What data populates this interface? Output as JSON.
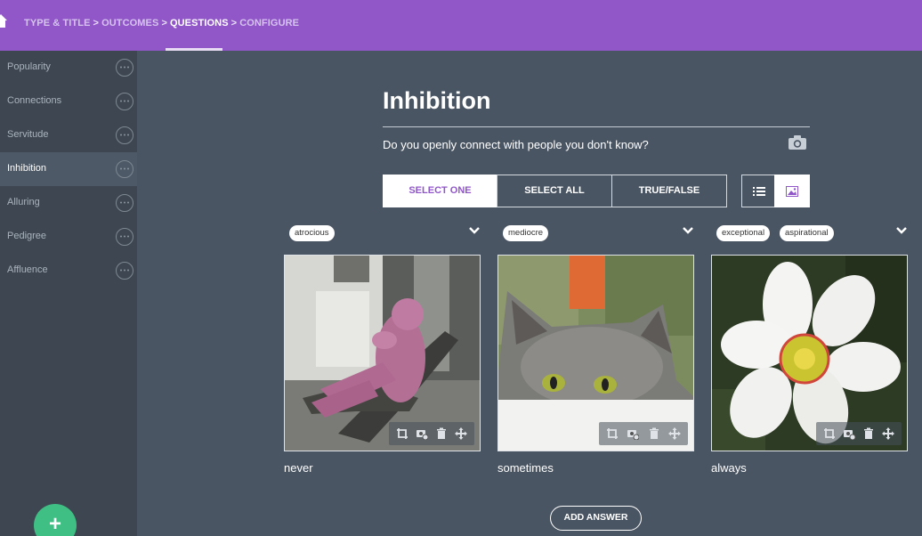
{
  "breadcrumb": {
    "steps": [
      "TYPE & TITLE",
      "OUTCOMES",
      "QUESTIONS",
      "CONFIGURE"
    ],
    "separator": ">"
  },
  "sidebar": {
    "items": [
      {
        "label": "Popularity"
      },
      {
        "label": "Connections"
      },
      {
        "label": "Servitude"
      },
      {
        "label": "Inhibition"
      },
      {
        "label": "Alluring"
      },
      {
        "label": "Pedigree"
      },
      {
        "label": "Affluence"
      }
    ],
    "active_item": "Inhibition",
    "add_label": "+"
  },
  "question": {
    "title": "Inhibition",
    "text": "Do you openly connect with people you don't know?",
    "types": [
      "SELECT ONE",
      "SELECT ALL",
      "TRUE/FALSE"
    ],
    "selected_type": "SELECT ONE",
    "view_modes": [
      "list-icon",
      "image-icon"
    ],
    "selected_view": "image-icon"
  },
  "answers": [
    {
      "label": "never",
      "tags": [
        "atrocious"
      ],
      "image": "person-in-pink-knit-suit"
    },
    {
      "label": "sometimes",
      "tags": [
        "mediocre"
      ],
      "image": "grey-cat-peeking"
    },
    {
      "label": "always",
      "tags": [
        "exceptional",
        "aspirational"
      ],
      "image": "white-daffodil-flower"
    }
  ],
  "add_answer_label": "ADD ANSWER",
  "colors": {
    "topbar": "#9157c9",
    "background": "#4a5563",
    "sidebar": "#3e4751",
    "add_button": "#3fbf84",
    "accent_text": "#9157c9"
  }
}
